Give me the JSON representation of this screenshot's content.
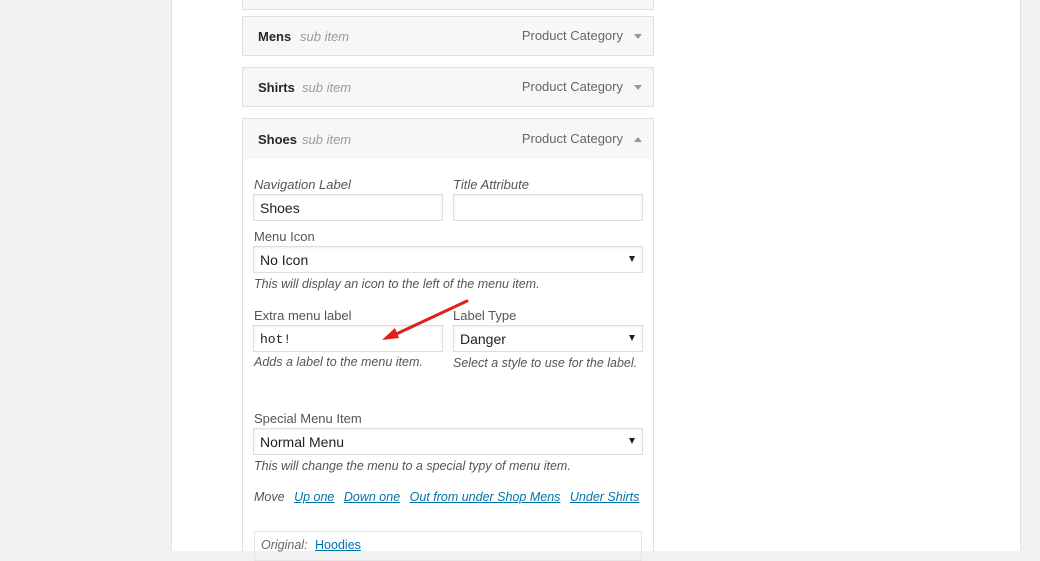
{
  "menu_items": [
    {
      "title": "Mens",
      "sub": "sub item",
      "type": "Product Category"
    },
    {
      "title": "Shirts",
      "sub": "sub item",
      "type": "Product Category"
    },
    {
      "title": "Shoes",
      "sub": "sub item",
      "type": "Product Category"
    }
  ],
  "settings": {
    "nav_label": {
      "label": "Navigation Label",
      "value": "Shoes"
    },
    "title_attr": {
      "label": "Title Attribute",
      "value": ""
    },
    "menu_icon": {
      "label": "Menu Icon",
      "value": "No Icon",
      "desc": "This will display an icon to the left of the menu item."
    },
    "extra_label": {
      "label": "Extra menu label",
      "value": "hot!",
      "desc": "Adds a label to the menu item."
    },
    "label_type": {
      "label": "Label Type",
      "value": "Danger",
      "desc": "Select a style to use for the label."
    },
    "special_item": {
      "label": "Special Menu Item",
      "value": "Normal Menu",
      "desc": "This will change the menu to a special typy of menu item."
    },
    "move": {
      "label": "Move",
      "links": [
        "Up one",
        "Down one",
        "Out from under Shop Mens",
        "Under Shirts"
      ]
    },
    "original": {
      "label": "Original:",
      "link": "Hoodies"
    }
  },
  "colors": {
    "accent_link": "#0073aa",
    "annotation_arrow": "#e0201b"
  }
}
